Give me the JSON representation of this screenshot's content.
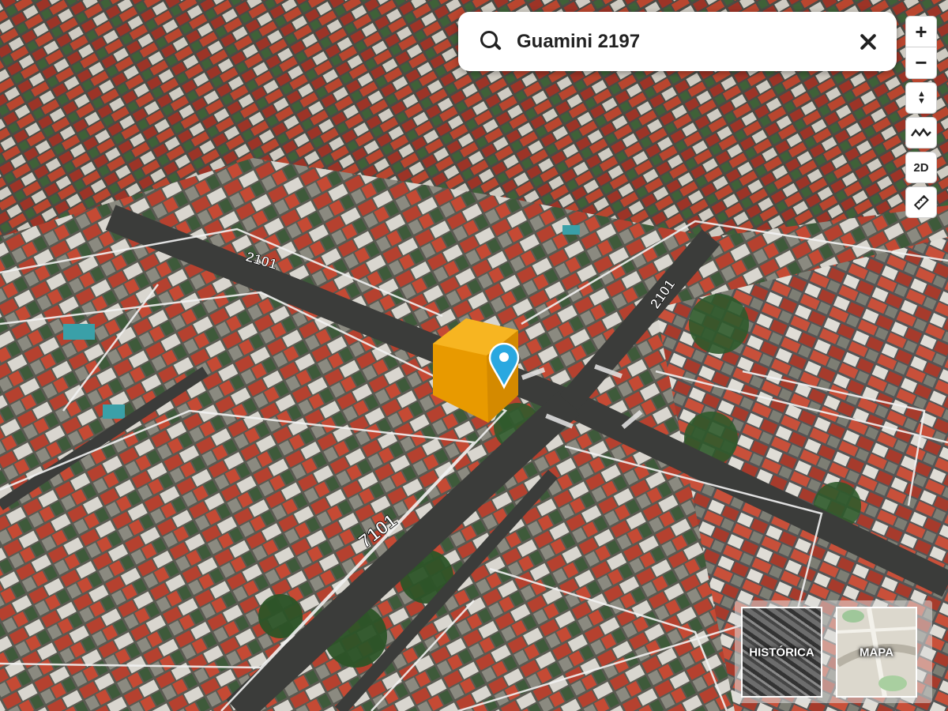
{
  "map": {
    "view": "3D aerial",
    "street_labels": [
      "2101",
      "2101",
      "7101"
    ],
    "marker": {
      "icon": "location-pin-icon",
      "building_color": "#f0a400",
      "pin_color": "#2aa8e0"
    }
  },
  "search": {
    "icon": "search-icon",
    "value": "Guamini 2197",
    "clear_icon": "close-icon"
  },
  "toolbar": {
    "zoom_in": "+",
    "zoom_out": "−",
    "tilt": "▲▼",
    "terrain_icon": "terrain-icon",
    "view_mode": "2D",
    "measure_icon": "ruler-icon"
  },
  "layers": {
    "historic_label": "HISTÓRICA",
    "map_label": "MAPA"
  },
  "colors": {
    "accent": "#2aa8e0",
    "building_highlight": "#f0a400"
  }
}
